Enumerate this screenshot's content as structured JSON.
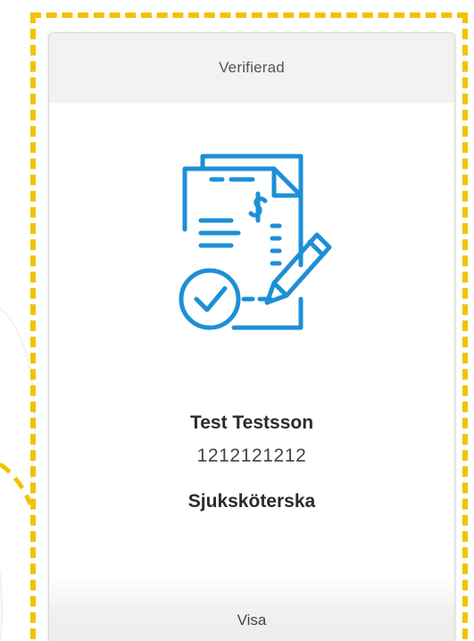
{
  "card": {
    "status_label": "Verifierad",
    "name": "Test Testsson",
    "personal_number": "1212121212",
    "role": "Sjuksköterska",
    "action_label": "Visa",
    "icon": "signed-document-verified-icon"
  },
  "colors": {
    "highlight_dash": "#F2C200",
    "icon_blue": "#1E8FD6",
    "header_bg": "#F2F2F2"
  }
}
